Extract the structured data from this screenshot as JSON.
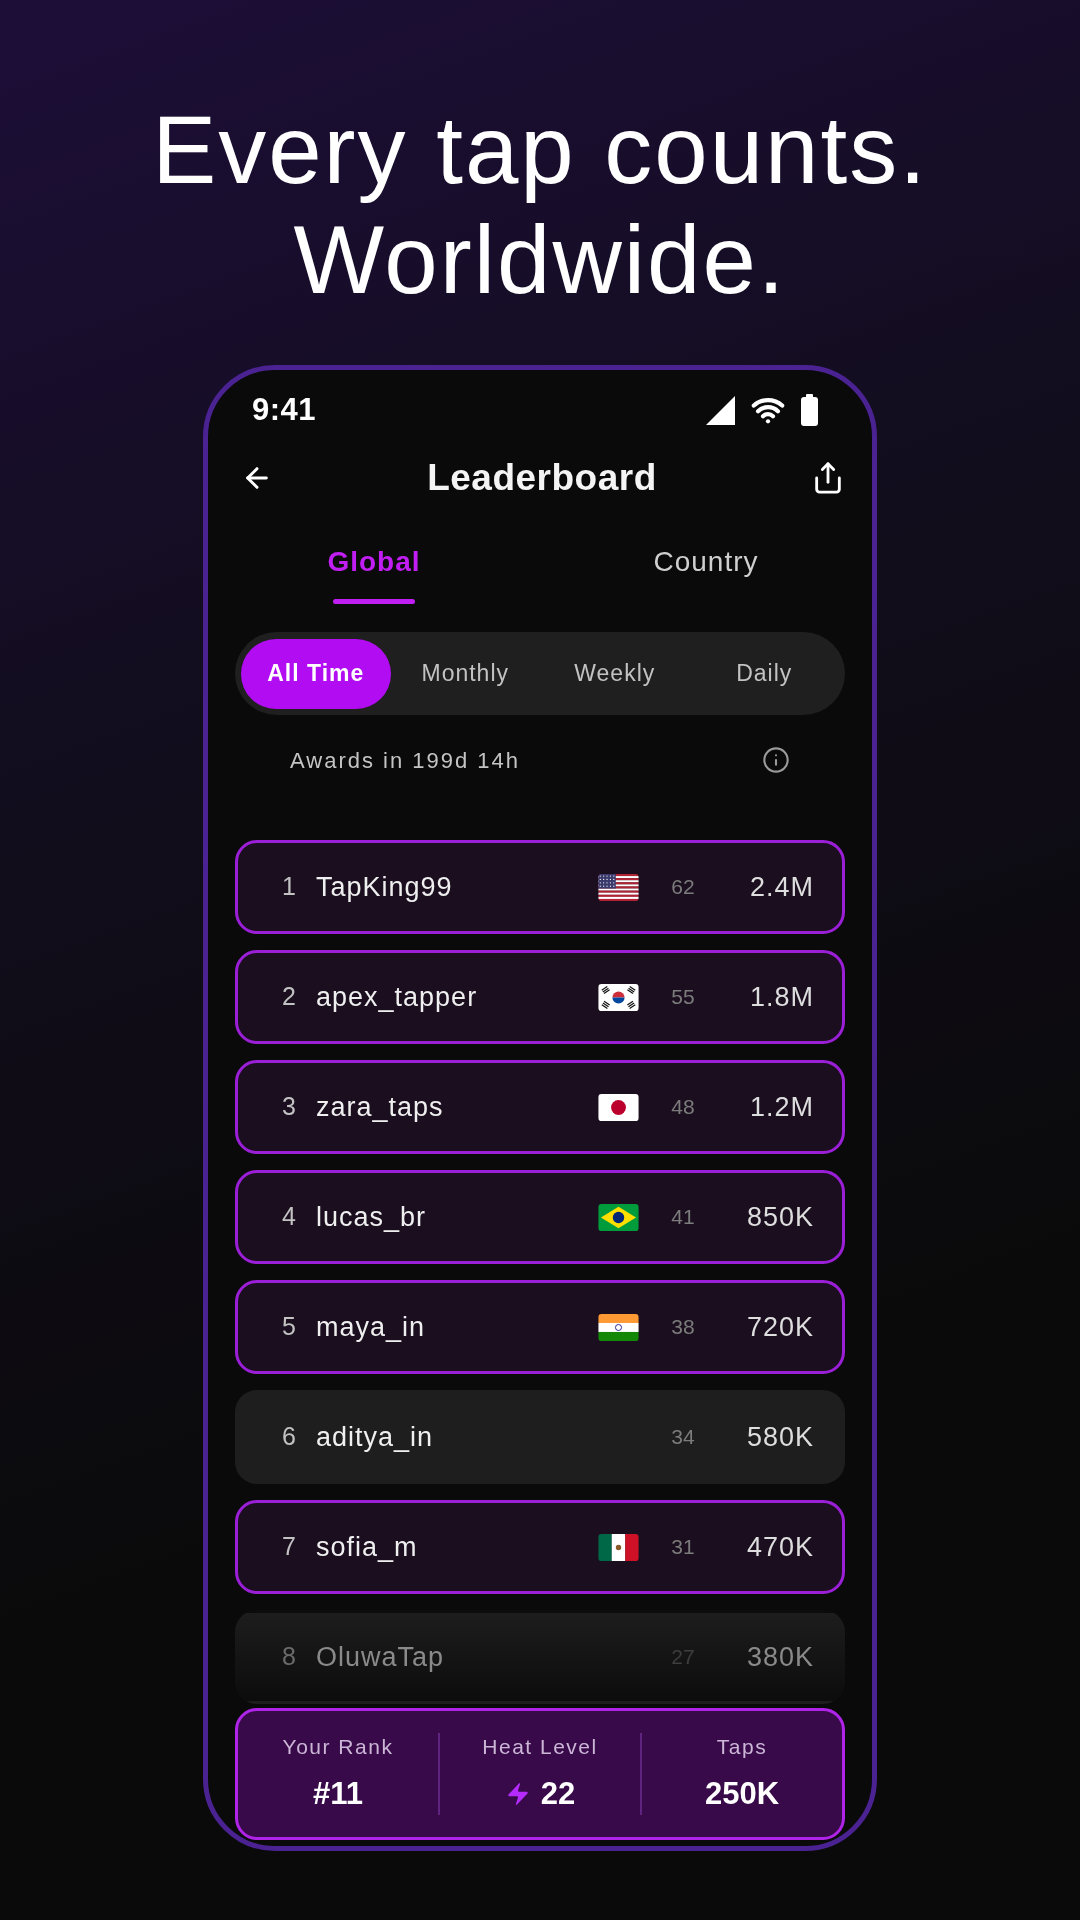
{
  "headline": "Every tap counts. Worldwide.",
  "status_bar": {
    "time": "9:41"
  },
  "header": {
    "title": "Leaderboard"
  },
  "tabs": [
    {
      "label": "Global",
      "selected": true
    },
    {
      "label": "Country",
      "selected": false
    }
  ],
  "periods": [
    {
      "label": "All Time",
      "selected": true
    },
    {
      "label": "Monthly",
      "selected": false
    },
    {
      "label": "Weekly",
      "selected": false
    },
    {
      "label": "Daily",
      "selected": false
    }
  ],
  "awards": {
    "text": "Awards in 199d 14h"
  },
  "rows": [
    {
      "kind": "usa",
      "rank": "1",
      "name": "TapKing99",
      "heat_level": "62",
      "taps": "2.4M",
      "highlighted": true
    },
    {
      "kind": "korea",
      "rank": "2",
      "name": "apex_tapper",
      "heat_level": "55",
      "taps": "1.8M",
      "highlighted": true
    },
    {
      "kind": "japan",
      "rank": "3",
      "name": "zara_taps",
      "heat_level": "48",
      "taps": "1.2M",
      "highlighted": true
    },
    {
      "kind": "brazil",
      "rank": "4",
      "name": "lucas_br",
      "heat_level": "41",
      "taps": "850K",
      "highlighted": true
    },
    {
      "kind": "india",
      "rank": "5",
      "name": "maya_in",
      "heat_level": "38",
      "taps": "720K",
      "highlighted": true
    },
    {
      "kind": "plain",
      "rank": "6",
      "name": "aditya_in",
      "heat_level": "34",
      "taps": "580K",
      "highlighted": false
    },
    {
      "kind": "mexico",
      "rank": "7",
      "name": "sofia_m",
      "heat_level": "31",
      "taps": "470K",
      "highlighted": true
    },
    {
      "kind": "plain",
      "rank": "8",
      "name": "OluwaTap",
      "heat_level": "27",
      "taps": "380K",
      "highlighted": false
    }
  ],
  "summary": [
    {
      "label": "Your Rank",
      "value": "#11",
      "kind": "plain"
    },
    {
      "label": "Heat Level",
      "value": "22",
      "kind": "heat"
    },
    {
      "label": "Taps",
      "value": "250K",
      "kind": "plain"
    }
  ]
}
